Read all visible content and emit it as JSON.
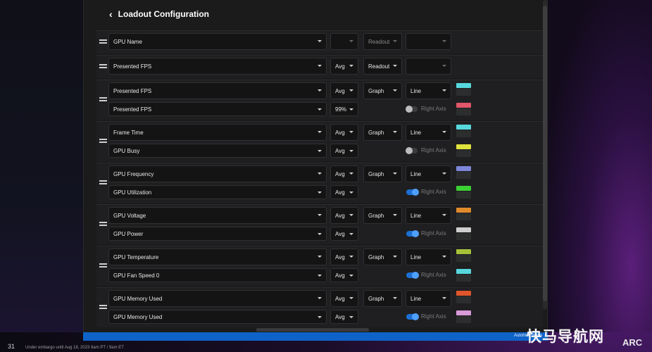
{
  "header": {
    "back_glyph": "‹",
    "title": "Loadout Configuration"
  },
  "right_axis_label": "Right Axis",
  "groups": [
    {
      "lines": [
        {
          "metric": "GPU Name",
          "stat": "",
          "stat_dim": true,
          "mode": "Readout",
          "mode_dim": true,
          "type": "",
          "type_dim": true
        }
      ]
    },
    {
      "lines": [
        {
          "metric": "Presented FPS",
          "stat": "Avg",
          "mode": "Readout",
          "type": "",
          "type_dim": true
        }
      ]
    },
    {
      "lines": [
        {
          "metric": "Presented FPS",
          "stat": "Avg",
          "mode": "Graph",
          "type": "Line",
          "color": "#57d8dd"
        },
        {
          "metric": "Presented FPS",
          "stat": "99%",
          "right_axis": false,
          "color": "#e0566a"
        }
      ]
    },
    {
      "lines": [
        {
          "metric": "Frame Time",
          "stat": "Avg",
          "mode": "Graph",
          "type": "Line",
          "color": "#57d8dd"
        },
        {
          "metric": "GPU Busy",
          "stat": "Avg",
          "right_axis": false,
          "color": "#dfe23c"
        }
      ]
    },
    {
      "lines": [
        {
          "metric": "GPU Frequency",
          "stat": "Avg",
          "mode": "Graph",
          "type": "Line",
          "color": "#7d86d8"
        },
        {
          "metric": "GPU Utilization",
          "stat": "Avg",
          "right_axis": true,
          "color": "#3cd034"
        }
      ]
    },
    {
      "lines": [
        {
          "metric": "GPU Voltage",
          "stat": "Avg",
          "mode": "Graph",
          "type": "Line",
          "color": "#e08a2c"
        },
        {
          "metric": "GPU Power",
          "stat": "Avg",
          "right_axis": true,
          "color": "#cfcfcf"
        }
      ]
    },
    {
      "lines": [
        {
          "metric": "GPU Temperature",
          "stat": "Avg",
          "mode": "Graph",
          "type": "Line",
          "color": "#a7c23a"
        },
        {
          "metric": "GPU Fan Speed 0",
          "stat": "Avg",
          "right_axis": true,
          "color": "#57d8dd"
        }
      ]
    },
    {
      "lines": [
        {
          "metric": "GPU Memory Used",
          "stat": "Avg",
          "mode": "Graph",
          "type": "Line",
          "color": "#e0562c"
        },
        {
          "metric": "GPU Memory Used",
          "stat": "Avg",
          "right_axis": true,
          "color": "#d99ad8"
        }
      ]
    }
  ],
  "statusbar": {
    "text": "Autohide 16ms"
  },
  "footer": {
    "page_number": "31",
    "embargo_text": "Under embargo until Aug 18, 2023 6am PT / 9am ET",
    "watermark": "快马导航网",
    "brand": "ARC"
  }
}
